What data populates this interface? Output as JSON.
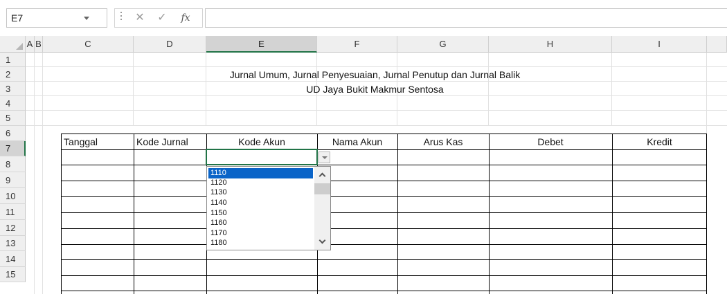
{
  "formula_bar": {
    "name_box": "E7",
    "cancel_glyph": "✕",
    "enter_glyph": "✓",
    "fx_label": "fx",
    "formula_value": ""
  },
  "columns": [
    "A",
    "B",
    "C",
    "D",
    "E",
    "F",
    "G",
    "H",
    "I"
  ],
  "selected_column": "E",
  "rows": [
    "1",
    "2",
    "3",
    "4",
    "5",
    "6",
    "7",
    "8",
    "9",
    "10",
    "11",
    "12",
    "13",
    "14",
    "15"
  ],
  "selected_row": "7",
  "sheet": {
    "title": "Jurnal Umum, Jurnal Penyesuaian, Jurnal Penutup dan Jurnal Balik",
    "subtitle": "UD Jaya Bukit Makmur Sentosa"
  },
  "table": {
    "headers": [
      "Tanggal",
      "Kode Jurnal",
      "Kode Akun",
      "Nama Akun",
      "Arus Kas",
      "Debet",
      "Kredit"
    ]
  },
  "dropdown": {
    "items": [
      "1110",
      "1120",
      "1130",
      "1140",
      "1150",
      "1160",
      "1170",
      "1180"
    ],
    "selected": "1110"
  },
  "icons": {
    "name_box_arrow": "chevron-down-icon",
    "cancel": "close-icon",
    "enter": "check-icon",
    "function": "fx-icon",
    "cell_dropdown": "chevron-down-icon",
    "scroll_up": "chevron-up-icon",
    "scroll_down": "chevron-down-icon"
  },
  "colors": {
    "selection_accent": "#217346",
    "dropdown_highlight": "#0a64c8"
  }
}
